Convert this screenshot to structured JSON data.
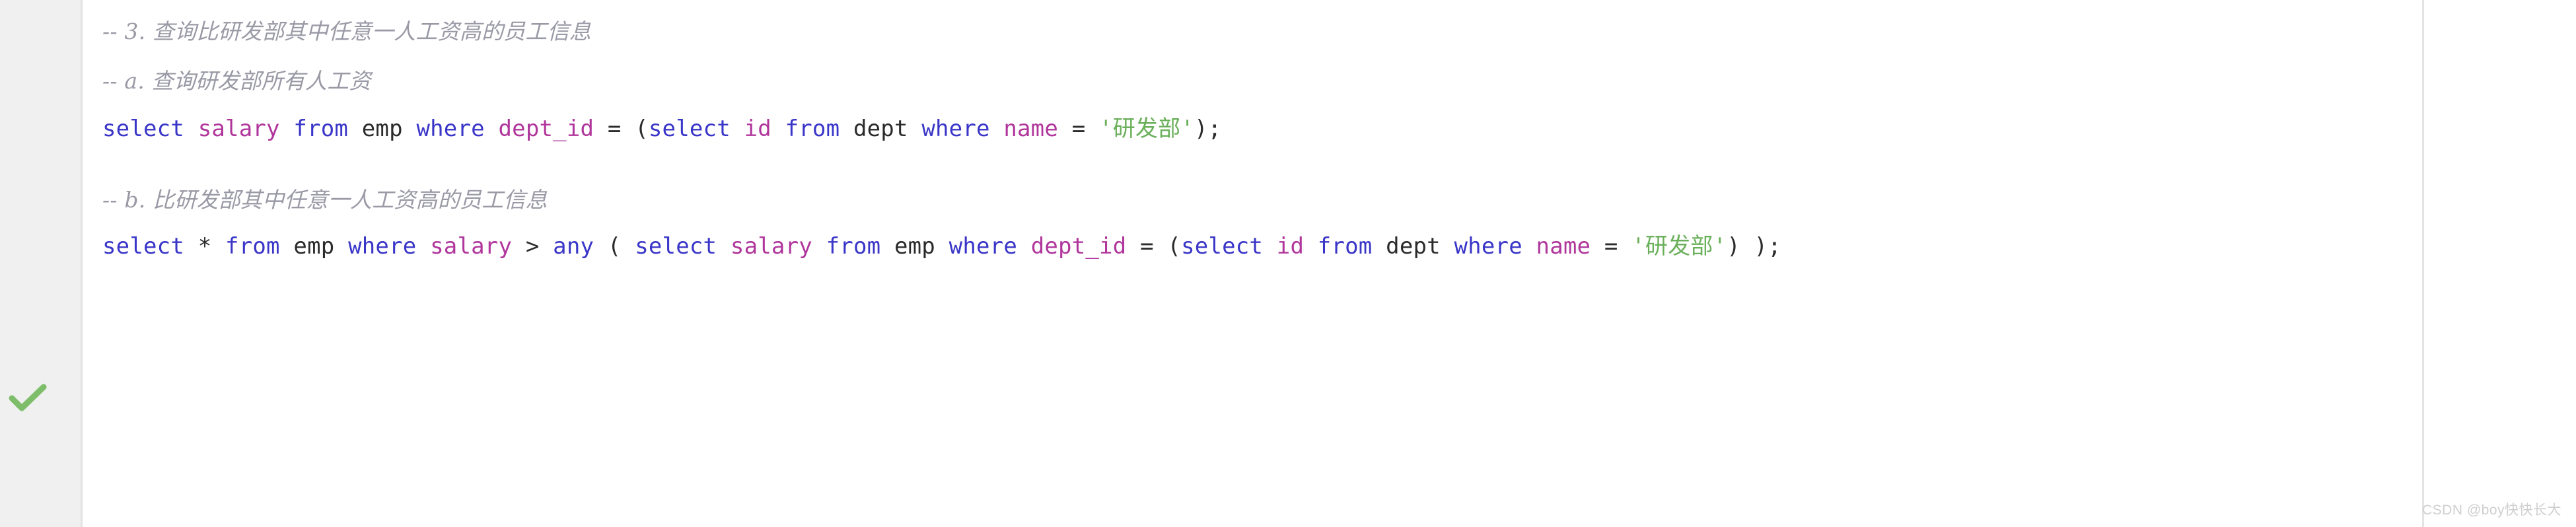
{
  "editor": {
    "background_color": "#ffffff",
    "gutter_color": "#f0f0f0",
    "gutter_border_color": "#e2e2e2"
  },
  "gutter": {
    "check_icon_name": "green-check-icon",
    "check_icon_color": "#7ebe6a"
  },
  "colors": {
    "comment": "#9a9aa6",
    "keyword": "#3a36c8",
    "field": "#b0369c",
    "table": "#2b2b2b",
    "operator": "#2b2b2b",
    "string": "#6aaf5a"
  },
  "lines": [
    {
      "id": "comment-3",
      "type": "comment",
      "text": "-- 3. 查询比研发部其中任意一人工资高的员工信息"
    },
    {
      "id": "comment-a",
      "type": "comment",
      "text": "-- a. 查询研发部所有人工资"
    },
    {
      "id": "sql-a",
      "type": "sql",
      "tokens": [
        {
          "t": "select",
          "c": "kw"
        },
        {
          "t": " ",
          "c": "punc"
        },
        {
          "t": "salary",
          "c": "fld"
        },
        {
          "t": " ",
          "c": "punc"
        },
        {
          "t": "from",
          "c": "kw"
        },
        {
          "t": " ",
          "c": "punc"
        },
        {
          "t": "emp",
          "c": "tbl"
        },
        {
          "t": " ",
          "c": "punc"
        },
        {
          "t": "where",
          "c": "kw"
        },
        {
          "t": " ",
          "c": "punc"
        },
        {
          "t": "dept_id",
          "c": "fld"
        },
        {
          "t": " ",
          "c": "punc"
        },
        {
          "t": "=",
          "c": "op"
        },
        {
          "t": " ",
          "c": "punc"
        },
        {
          "t": "(",
          "c": "punc"
        },
        {
          "t": "select",
          "c": "kw"
        },
        {
          "t": " ",
          "c": "punc"
        },
        {
          "t": "id",
          "c": "fld"
        },
        {
          "t": " ",
          "c": "punc"
        },
        {
          "t": "from",
          "c": "kw"
        },
        {
          "t": " ",
          "c": "punc"
        },
        {
          "t": "dept",
          "c": "tbl"
        },
        {
          "t": " ",
          "c": "punc"
        },
        {
          "t": "where",
          "c": "kw"
        },
        {
          "t": " ",
          "c": "punc"
        },
        {
          "t": "name",
          "c": "fld"
        },
        {
          "t": " ",
          "c": "punc"
        },
        {
          "t": "=",
          "c": "op"
        },
        {
          "t": " ",
          "c": "punc"
        },
        {
          "t": "'研发部'",
          "c": "str"
        },
        {
          "t": ");",
          "c": "punc"
        }
      ],
      "plain": "select salary from emp where dept_id = (select id from dept where name = '研发部');"
    },
    {
      "id": "comment-b",
      "type": "comment",
      "text": "-- b. 比研发部其中任意一人工资高的员工信息"
    },
    {
      "id": "sql-b",
      "type": "sql",
      "marker": "green-check-icon",
      "tokens": [
        {
          "t": "select",
          "c": "kw"
        },
        {
          "t": " ",
          "c": "punc"
        },
        {
          "t": "*",
          "c": "op"
        },
        {
          "t": " ",
          "c": "punc"
        },
        {
          "t": "from",
          "c": "kw"
        },
        {
          "t": " ",
          "c": "punc"
        },
        {
          "t": "emp",
          "c": "tbl"
        },
        {
          "t": " ",
          "c": "punc"
        },
        {
          "t": "where",
          "c": "kw"
        },
        {
          "t": " ",
          "c": "punc"
        },
        {
          "t": "salary",
          "c": "fld"
        },
        {
          "t": " ",
          "c": "punc"
        },
        {
          "t": ">",
          "c": "op"
        },
        {
          "t": " ",
          "c": "punc"
        },
        {
          "t": "any",
          "c": "kw"
        },
        {
          "t": " ( ",
          "c": "punc"
        },
        {
          "t": "select",
          "c": "kw"
        },
        {
          "t": " ",
          "c": "punc"
        },
        {
          "t": "salary",
          "c": "fld"
        },
        {
          "t": " ",
          "c": "punc"
        },
        {
          "t": "from",
          "c": "kw"
        },
        {
          "t": " ",
          "c": "punc"
        },
        {
          "t": "emp",
          "c": "tbl"
        },
        {
          "t": " ",
          "c": "punc"
        },
        {
          "t": "where",
          "c": "kw"
        },
        {
          "t": " ",
          "c": "punc"
        },
        {
          "t": "dept_id",
          "c": "fld"
        },
        {
          "t": " ",
          "c": "punc"
        },
        {
          "t": "=",
          "c": "op"
        },
        {
          "t": " ",
          "c": "punc"
        },
        {
          "t": "(",
          "c": "punc"
        },
        {
          "t": "select",
          "c": "kw"
        },
        {
          "t": " ",
          "c": "punc"
        },
        {
          "t": "id",
          "c": "fld"
        },
        {
          "t": " ",
          "c": "punc"
        },
        {
          "t": "from",
          "c": "kw"
        },
        {
          "t": " ",
          "c": "punc"
        },
        {
          "t": "dept",
          "c": "tbl"
        },
        {
          "t": " ",
          "c": "punc"
        },
        {
          "t": "where",
          "c": "kw"
        },
        {
          "t": " ",
          "c": "punc"
        },
        {
          "t": "name",
          "c": "fld"
        },
        {
          "t": " ",
          "c": "punc"
        },
        {
          "t": "=",
          "c": "op"
        },
        {
          "t": " ",
          "c": "punc"
        },
        {
          "t": "'研发部'",
          "c": "str"
        },
        {
          "t": ")",
          "c": "punc"
        },
        {
          "t": " );",
          "c": "punc"
        }
      ],
      "plain": "select * from emp where salary > any ( select salary from emp where dept_id = (select id from dept where name = '研发部') );"
    }
  ],
  "watermark": {
    "text": "CSDN @boy快快长大"
  }
}
